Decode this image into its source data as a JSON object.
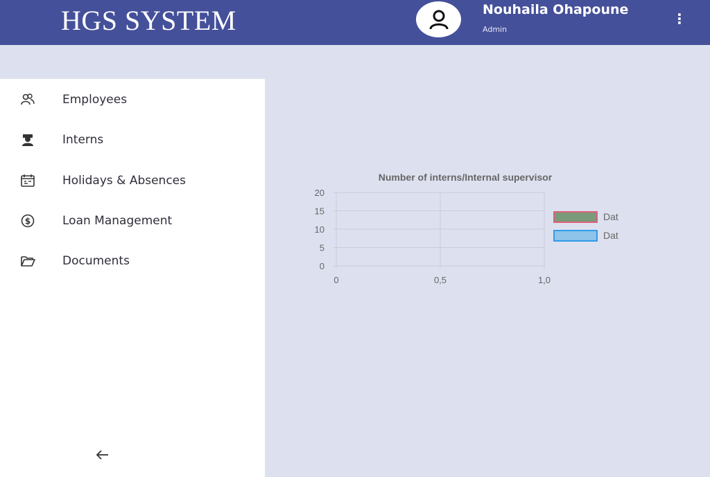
{
  "app": {
    "title": "HGS SYSTEM"
  },
  "user": {
    "name": "Nouhaila Ohapoune",
    "role": "Admin",
    "avatar_icon": "user-icon"
  },
  "header": {
    "menu_icon": "kebab-menu-icon"
  },
  "sidebar": {
    "items": [
      {
        "label": "Employees",
        "icon": "users-icon"
      },
      {
        "label": "Interns",
        "icon": "graduate-icon"
      },
      {
        "label": "Holidays & Absences",
        "icon": "calendar-icon"
      },
      {
        "label": "Loan Management",
        "icon": "dollar-icon"
      },
      {
        "label": "Documents",
        "icon": "folder-open-icon"
      }
    ],
    "collapse_icon": "arrow-left-icon"
  },
  "colors": {
    "topbar": "#45509a",
    "background": "#dde1ef",
    "series1_fill": "#7a9a7a",
    "series1_border": "#e0607a",
    "series2_fill": "#8ec3ea",
    "series2_border": "#2f9bea"
  },
  "chart_data": {
    "type": "bar",
    "title": "Number of interns/Internal supervisor",
    "xlabel": "",
    "ylabel": "",
    "x_ticks": [
      "0",
      "0,5",
      "1,0"
    ],
    "y_ticks": [
      "0",
      "5",
      "10",
      "15",
      "20"
    ],
    "xlim": [
      0,
      1
    ],
    "ylim": [
      0,
      20
    ],
    "grid": true,
    "legend_position": "right",
    "series": [
      {
        "name": "Dat",
        "values": []
      },
      {
        "name": "Dat",
        "values": []
      }
    ]
  }
}
